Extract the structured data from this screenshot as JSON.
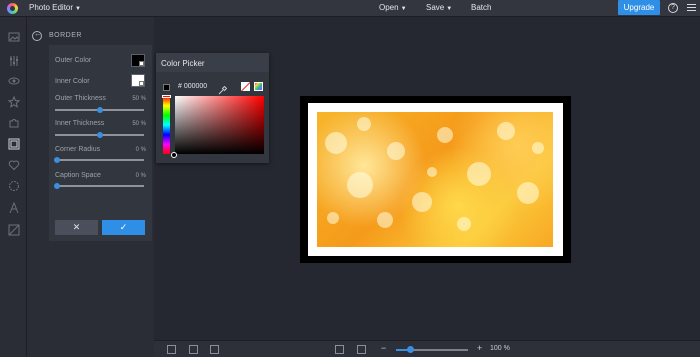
{
  "topbar": {
    "app_title": "Photo Editor",
    "menu": [
      "Open",
      "Save",
      "Batch"
    ],
    "upgrade_label": "Upgrade",
    "help_label": "?"
  },
  "panel": {
    "title": "BORDER",
    "outer_color": {
      "label": "Outer Color",
      "value": "#000000"
    },
    "inner_color": {
      "label": "Inner Color",
      "value": "#ffffff"
    },
    "outer_thickness": {
      "label": "Outer Thickness",
      "value": "50 %",
      "level": 0.5
    },
    "inner_thickness": {
      "label": "Inner Thickness",
      "value": "50 %",
      "level": 0.5
    },
    "corner_radius": {
      "label": "Corner Radius",
      "value": "0 %",
      "level": 0
    },
    "caption_space": {
      "label": "Caption Space",
      "value": "0 %",
      "level": 0
    },
    "cancel_label": "✕",
    "apply_label": "✓"
  },
  "color_picker": {
    "title": "Color Picker",
    "hex": "# 000000"
  },
  "zoom": {
    "minus": "−",
    "plus": "+",
    "value": "100 %",
    "level": 0.2
  },
  "colors": {
    "accent": "#2f8ee6",
    "background": "#252830",
    "panel": "#2a2d35"
  }
}
